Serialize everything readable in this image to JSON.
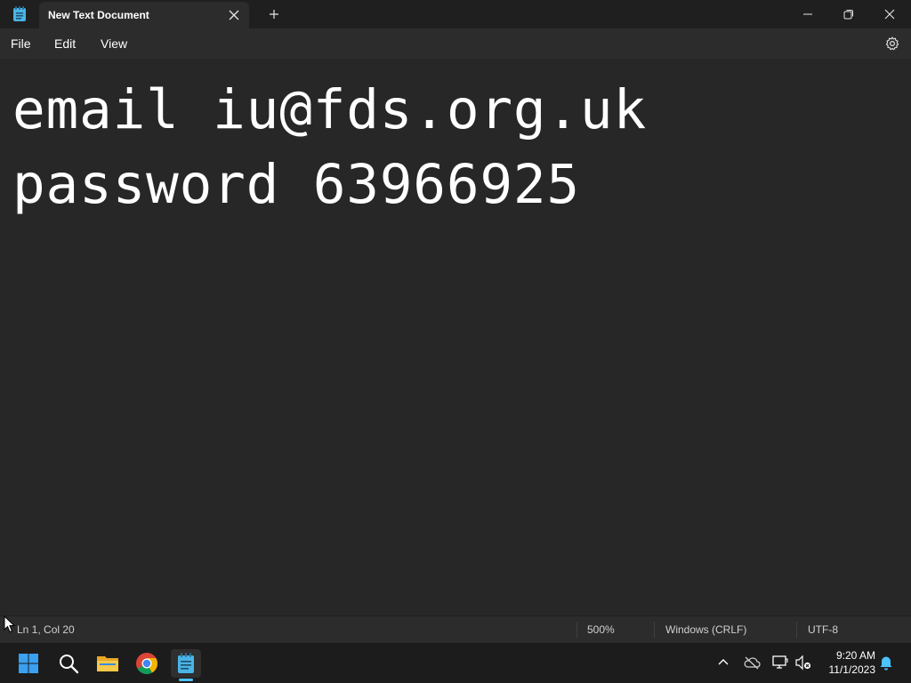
{
  "window": {
    "tab_title": "New Text Document"
  },
  "menu": {
    "file": "File",
    "edit": "Edit",
    "view": "View"
  },
  "editor": {
    "lines": [
      "email iu@fds.org.uk",
      "password 63966925"
    ]
  },
  "statusbar": {
    "position": "Ln 1, Col 20",
    "zoom": "500%",
    "line_ending": "Windows (CRLF)",
    "encoding": "UTF-8"
  },
  "taskbar": {
    "apps": [
      "start-icon",
      "search-icon",
      "file-explorer-icon",
      "chrome-icon",
      "notepad-icon"
    ],
    "active_app": "notepad-icon",
    "time": "9:20 AM",
    "date": "11/1/2023"
  },
  "colors": {
    "background": "#272727",
    "titlebar": "#1f1f1f",
    "accent": "#4cc2ff"
  }
}
